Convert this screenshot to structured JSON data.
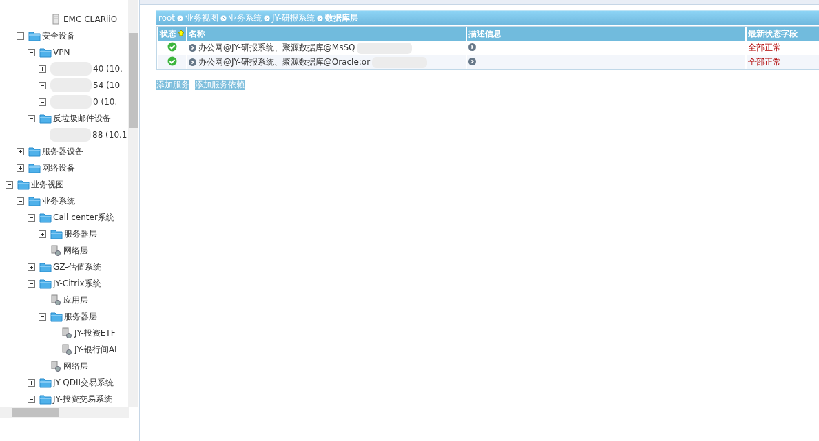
{
  "tree": [
    {
      "children": [
        {
          "children": [
            {
              "children": [
                {
                  "kind": "server",
                  "label": "EMC CLARiiO"
                }
              ]
            }
          ]
        },
        {
          "kind": "folder",
          "label": "安全设备",
          "expanded": true,
          "children": [
            {
              "kind": "folder",
              "label": "VPN",
              "expanded": true,
              "children": [
                {
                  "kind": "host",
                  "label": "40 (10.",
                  "expanded": false
                },
                {
                  "kind": "host",
                  "label": "54  (10",
                  "expanded": true
                },
                {
                  "kind": "host",
                  "label": "0 (10.",
                  "expanded": true
                }
              ]
            },
            {
              "kind": "folder",
              "label": "反垃圾邮件设备",
              "expanded": true,
              "children": [
                {
                  "kind": "host",
                  "label": "88 (10.1"
                }
              ]
            }
          ]
        },
        {
          "kind": "folder",
          "label": "服务器设备",
          "expanded": false
        },
        {
          "kind": "folder",
          "label": "网络设备",
          "expanded": false
        }
      ]
    },
    {
      "kind": "folder",
      "label": "业务视图",
      "expanded": true,
      "children": [
        {
          "kind": "folder",
          "label": "业务系统",
          "expanded": true,
          "children": [
            {
              "kind": "folder",
              "label": "Call center系统",
              "expanded": true,
              "children": [
                {
                  "kind": "folder",
                  "label": "服务器层",
                  "expanded": false
                },
                {
                  "kind": "service",
                  "label": "网络层"
                }
              ]
            },
            {
              "kind": "folder",
              "label": "GZ-估值系统",
              "expanded": false
            },
            {
              "kind": "folder",
              "label": "JY-Citrix系统",
              "expanded": true,
              "children": [
                {
                  "kind": "service",
                  "label": "应用层"
                },
                {
                  "kind": "folder",
                  "label": "服务器层",
                  "expanded": true,
                  "children": [
                    {
                      "kind": "service",
                      "label": "JY-投资ETF"
                    },
                    {
                      "kind": "service",
                      "label": "JY-银行间AI"
                    }
                  ]
                },
                {
                  "kind": "service",
                  "label": "网络层"
                }
              ]
            },
            {
              "kind": "folder",
              "label": "JY-QDII交易系统",
              "expanded": false
            },
            {
              "kind": "folder",
              "label": "JY-投资交易系统",
              "expanded": true
            }
          ]
        }
      ]
    }
  ],
  "breadcrumb": [
    "root",
    "业务视图",
    "业务系统",
    "JY-研报系统",
    "数据库层"
  ],
  "table": {
    "columns": [
      {
        "label": "状态",
        "sorted": true
      },
      {
        "label": "名称",
        "sorted": false
      },
      {
        "label": "描述信息",
        "sorted": false
      },
      {
        "label": "最新状态字段",
        "sorted": false
      }
    ],
    "rows": [
      {
        "ok": true,
        "name": "办公网@JY-研报系统、聚源数据库@MsSQ",
        "latest": "全部正常"
      },
      {
        "ok": true,
        "name": "办公网@JY-研报系统、聚源数据库@Oracle:or",
        "latest": "全部正常"
      }
    ]
  },
  "actions": [
    "添加服务",
    "添加服务依赖"
  ]
}
